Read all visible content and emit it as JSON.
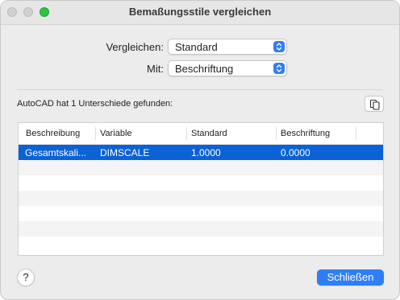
{
  "window": {
    "title": "Bemaßungsstile vergleichen"
  },
  "compare": {
    "label1": "Vergleichen:",
    "value1": "Standard",
    "label2": "Mit:",
    "value2": "Beschriftung"
  },
  "result_text": "AutoCAD hat 1 Unterschiede gefunden:",
  "table": {
    "columns": [
      "Beschreibung",
      "Variable",
      "Standard",
      "Beschriftung"
    ],
    "rows": [
      [
        "Gesamtskali...",
        "DIMSCALE",
        "1.0000",
        "0.0000"
      ]
    ]
  },
  "buttons": {
    "help": "?",
    "close": "Schließen"
  },
  "colors": {
    "accent": "#2f7ef6",
    "selection": "#0a62d6"
  }
}
